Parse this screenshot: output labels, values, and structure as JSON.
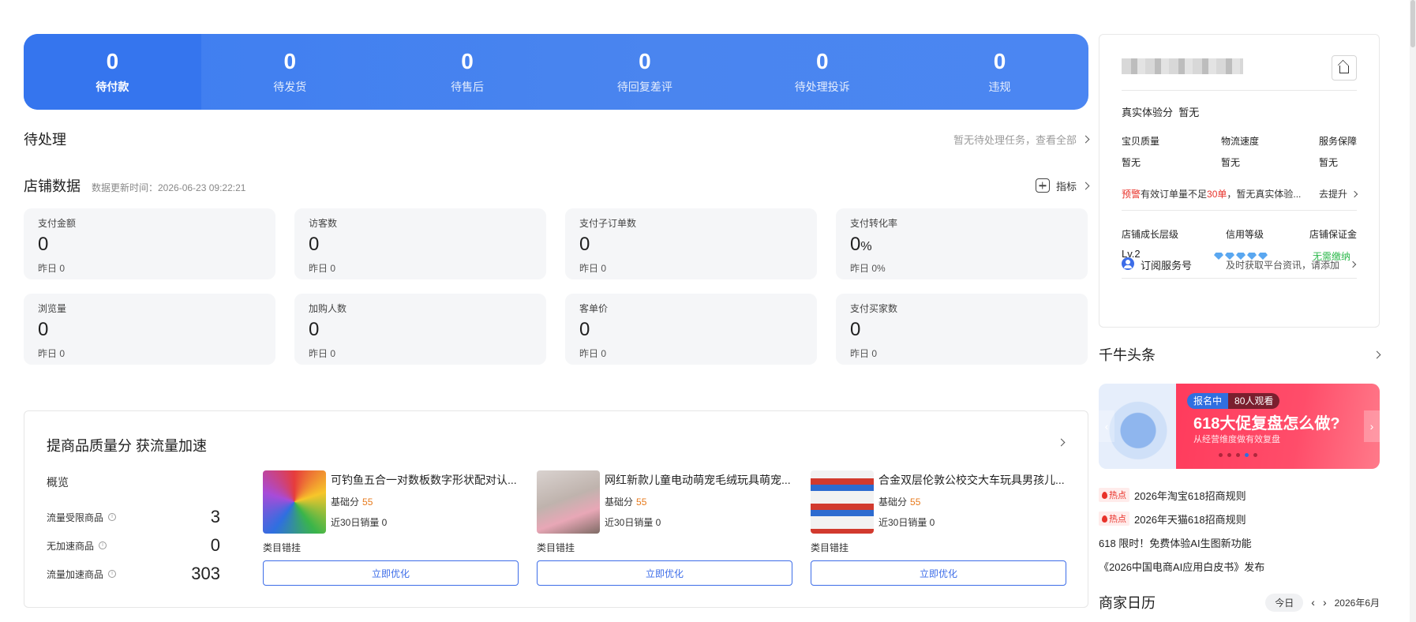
{
  "status_bar": [
    {
      "value": "0",
      "label": "待付款"
    },
    {
      "value": "0",
      "label": "待发货"
    },
    {
      "value": "0",
      "label": "待售后"
    },
    {
      "value": "0",
      "label": "待回复差评"
    },
    {
      "value": "0",
      "label": "待处理投诉"
    },
    {
      "value": "0",
      "label": "违规"
    }
  ],
  "todo": {
    "title": "待处理",
    "hint": "暂无待处理任务，查看全部"
  },
  "store_data": {
    "title": "店铺数据",
    "update_time": "数据更新时间：2026-06-23 09:22:21",
    "indicator_label": "指标",
    "metrics": [
      {
        "label": "支付金额",
        "value": "0",
        "unit": "",
        "yesterday": "昨日 0"
      },
      {
        "label": "访客数",
        "value": "0",
        "unit": "",
        "yesterday": "昨日 0"
      },
      {
        "label": "支付子订单数",
        "value": "0",
        "unit": "",
        "yesterday": "昨日 0"
      },
      {
        "label": "支付转化率",
        "value": "0",
        "unit": "%",
        "yesterday": "昨日 0%"
      },
      {
        "label": "浏览量",
        "value": "0",
        "unit": "",
        "yesterday": "昨日 0"
      },
      {
        "label": "加购人数",
        "value": "0",
        "unit": "",
        "yesterday": "昨日 0"
      },
      {
        "label": "客单价",
        "value": "0",
        "unit": "",
        "yesterday": "昨日 0"
      },
      {
        "label": "支付买家数",
        "value": "0",
        "unit": "",
        "yesterday": "昨日 0"
      }
    ]
  },
  "quality": {
    "title": "提商品质量分 获流量加速",
    "overview_title": "概览",
    "overview": [
      {
        "label": "流量受限商品",
        "value": "3"
      },
      {
        "label": "无加速商品",
        "value": "0"
      },
      {
        "label": "流量加速商品",
        "value": "303"
      }
    ],
    "products": [
      {
        "name": "可钓鱼五合一对数板数字形状配对认...",
        "score_label": "基础分",
        "score": "55",
        "sales": "近30日销量 0",
        "category": "类目错挂",
        "button": "立即优化"
      },
      {
        "name": "网红新款儿童电动萌宠毛绒玩具萌宠...",
        "score_label": "基础分",
        "score": "55",
        "sales": "近30日销量 0",
        "category": "类目错挂",
        "button": "立即优化"
      },
      {
        "name": "合金双层伦敦公校交大车玩具男孩儿...",
        "score_label": "基础分",
        "score": "55",
        "sales": "近30日销量 0",
        "category": "类目错挂",
        "button": "立即优化"
      }
    ]
  },
  "shop_panel": {
    "experience_label": "真实体验分",
    "experience_value": "暂无",
    "sub_scores": [
      {
        "label": "宝贝质量",
        "value": "暂无"
      },
      {
        "label": "物流速度",
        "value": "暂无"
      },
      {
        "label": "服务保障",
        "value": "暂无"
      }
    ],
    "warning_tag": "预警",
    "warning_pre": "有效订单量不足",
    "warning_num": "30单",
    "warning_post": "，暂无真实体验...",
    "improve_link": "去提升",
    "growth_label": "店铺成长层级",
    "growth_value": "Lv.2",
    "credit_label": "信用等级",
    "deposit_label": "店铺保证金",
    "deposit_value": "无需缴纳",
    "subscribe_label": "订阅服务号",
    "subscribe_hint": "及时获取平台资讯，请添加",
    "accent_green": "#2cb84b"
  },
  "headlines": {
    "title": "千牛头条",
    "banner_tag": "报名中",
    "banner_viewers": "80人观看",
    "banner_title": "618大促复盘怎么做?",
    "banner_sub": "从经营维度做有效复盘",
    "news": [
      {
        "hot": "热点",
        "text": "2026年淘宝618招商规则"
      },
      {
        "hot": "热点",
        "text": "2026年天猫618招商规则"
      },
      {
        "hot": "",
        "text": "618 限时！免费体验AI生图新功能"
      },
      {
        "hot": "",
        "text": "《2026中国电商AI应用白皮书》发布"
      }
    ]
  },
  "calendar": {
    "title": "商家日历",
    "today": "今日",
    "month": "2026年6月"
  },
  "colors": {
    "brand_blue": "#3d7df0",
    "warning_red": "#e8322a",
    "score_orange": "#e77a1c"
  }
}
